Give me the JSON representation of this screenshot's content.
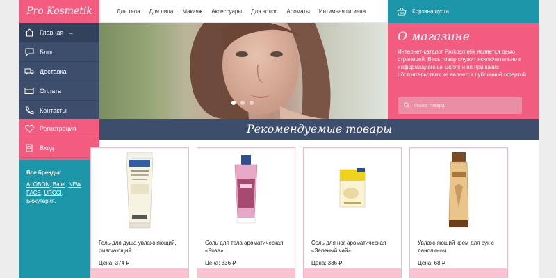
{
  "logo": "Pro Kosmetik",
  "side_nav": [
    {
      "label": "Главная",
      "arrow": "→"
    },
    {
      "label": "Блог"
    },
    {
      "label": "Доставка"
    },
    {
      "label": "Оплата"
    },
    {
      "label": "Контакты"
    }
  ],
  "auth": [
    {
      "label": "Регистрация"
    },
    {
      "label": "Вход"
    }
  ],
  "brands": {
    "label": "Все бренды:",
    "links": [
      "ALOBON",
      "Batel",
      "NEW FACE",
      "URCCI",
      "Бижутерия"
    ]
  },
  "top_menu": [
    "Для тела",
    "Для лица",
    "Макияж",
    "Аксессуары",
    "Для волос",
    "Ароматы",
    "Интимная гигиена"
  ],
  "cart": {
    "label": "Корзина пуста"
  },
  "about": {
    "title": "О магазине",
    "text": "Интернет-каталог Prokosmetik является демо страницей. Весь товар служит исключительно в информационных целях и не при каких обстоятельствах не является публичной офертой",
    "search_placeholder": "Поиск товара"
  },
  "featured_title": "Рекомендуемые товары",
  "slider": {
    "active_dot": 1,
    "dot_count": 3
  },
  "products": [
    {
      "name": "Гель для душа увлажняющий, смягчающий",
      "price": "Цена: 374 ₽"
    },
    {
      "name": "Соль для тела ароматическая «Роза»",
      "price": "Цена: 336 ₽"
    },
    {
      "name": "Соль для ног ароматическая «Зеленый чай»",
      "price": "Цена: 336 ₽"
    },
    {
      "name": "Увлажняющий крем для рук с ланолином",
      "price": "Цена: 68 ₽"
    }
  ],
  "colors": {
    "pink": "#f25c7f",
    "navy": "#3d4e6c",
    "teal": "#1b96a8"
  }
}
